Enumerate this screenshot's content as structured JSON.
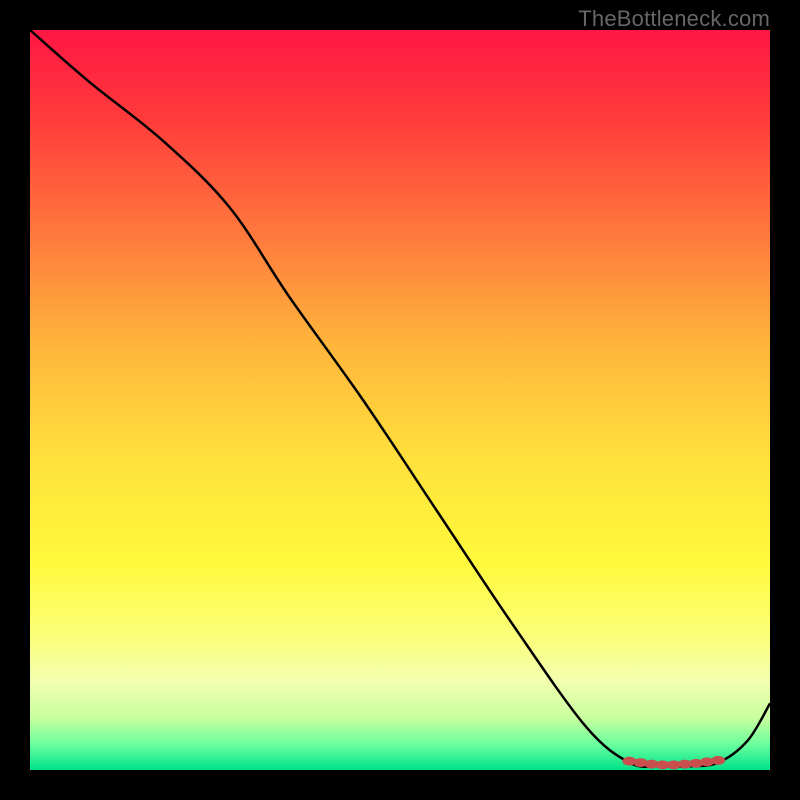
{
  "watermark": "TheBottleneck.com",
  "chart_data": {
    "type": "line",
    "title": "",
    "xlabel": "",
    "ylabel": "",
    "xlim": [
      0,
      100
    ],
    "ylim": [
      0,
      100
    ],
    "background_gradient": {
      "stops": [
        {
          "offset": 0.0,
          "color": "#ff1744"
        },
        {
          "offset": 0.12,
          "color": "#ff3b3b"
        },
        {
          "offset": 0.28,
          "color": "#ff7a3c"
        },
        {
          "offset": 0.42,
          "color": "#ffb33c"
        },
        {
          "offset": 0.58,
          "color": "#ffe13c"
        },
        {
          "offset": 0.72,
          "color": "#fff93c"
        },
        {
          "offset": 0.82,
          "color": "#fcff7a"
        },
        {
          "offset": 0.88,
          "color": "#f2ffb0"
        },
        {
          "offset": 0.93,
          "color": "#c8ff9e"
        },
        {
          "offset": 0.965,
          "color": "#6bff9e"
        },
        {
          "offset": 1.0,
          "color": "#00e28a"
        }
      ]
    },
    "series": [
      {
        "name": "curve",
        "x": [
          0,
          8,
          18,
          27,
          35,
          45,
          55,
          65,
          75,
          81,
          85,
          89,
          93,
          97,
          100
        ],
        "y": [
          100,
          93,
          85,
          76,
          64,
          50,
          35,
          20,
          6,
          1,
          0.5,
          0.5,
          1,
          4,
          9
        ]
      }
    ],
    "markers": {
      "name": "bottom-points",
      "color": "#c94f4f",
      "x": [
        81.0,
        82.5,
        84.0,
        85.5,
        87.0,
        88.5,
        90.0,
        91.5,
        93.0
      ],
      "y": [
        1.2,
        1.0,
        0.8,
        0.7,
        0.7,
        0.8,
        0.9,
        1.1,
        1.3
      ]
    }
  }
}
